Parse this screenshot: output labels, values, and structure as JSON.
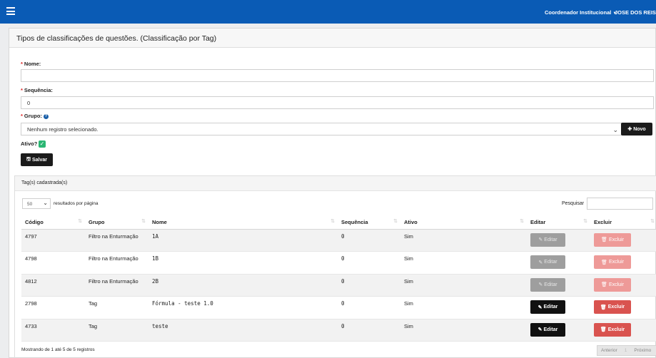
{
  "topbar": {
    "role": "Coordenador Institucional",
    "user": "JOSE DOS REIS"
  },
  "page": {
    "title": "Tipos de classificações de questões. (Classificação por Tag)"
  },
  "form": {
    "required_mark": "*",
    "nome_label": "Nome:",
    "nome_value": "",
    "sequencia_label": "Sequência:",
    "sequencia_value": "0",
    "grupo_label": "Grupo:",
    "grupo_value": "Nenhum registro selecionado.",
    "novo_label": "Novo",
    "ativo_label": "Ativo?",
    "ativo_checked": true,
    "salvar_label": "Salvar"
  },
  "tags_panel": {
    "title": "Tag(s) cadastrada(s)",
    "per_page_value": "50",
    "per_page_label": "resultados por página",
    "search_label": "Pesquisar",
    "columns": [
      "Código",
      "Grupo",
      "Nome",
      "Sequência",
      "Ativo",
      "Editar",
      "Excluir"
    ],
    "rows": [
      {
        "codigo": "4797",
        "grupo": "Filtro na Enturmação",
        "nome": "1A",
        "sequencia": "0",
        "ativo": "Sim",
        "enabled": false
      },
      {
        "codigo": "4798",
        "grupo": "Filtro na Enturmação",
        "nome": "1B",
        "sequencia": "0",
        "ativo": "Sim",
        "enabled": false
      },
      {
        "codigo": "4812",
        "grupo": "Filtro na Enturmação",
        "nome": "2B",
        "sequencia": "0",
        "ativo": "Sim",
        "enabled": false
      },
      {
        "codigo": "2798",
        "grupo": "Tag",
        "nome": "Fórmula - teste 1.0",
        "sequencia": "0",
        "ativo": "Sim",
        "enabled": true
      },
      {
        "codigo": "4733",
        "grupo": "Tag",
        "nome": "teste",
        "sequencia": "0",
        "ativo": "Sim",
        "enabled": true
      }
    ],
    "edit_label": "Editar",
    "delete_label": "Excluir",
    "footer_info": "Mostrando de 1 até 5 de 5 registros",
    "pager": {
      "prev": "Anterior",
      "page": "1",
      "next": "Próximo"
    }
  },
  "colors": {
    "topbar": "#0a5bb5",
    "edit_active": "#111111",
    "delete_active": "#d9534f",
    "delete_disabled": "#ee9a98",
    "check": "#2bb673"
  },
  "icons": [
    "menu-icon",
    "caret-down-icon",
    "help-icon",
    "chevron-down-icon",
    "plus-icon",
    "check-icon",
    "save-icon",
    "sort-icon",
    "edit-icon",
    "trash-icon"
  ]
}
